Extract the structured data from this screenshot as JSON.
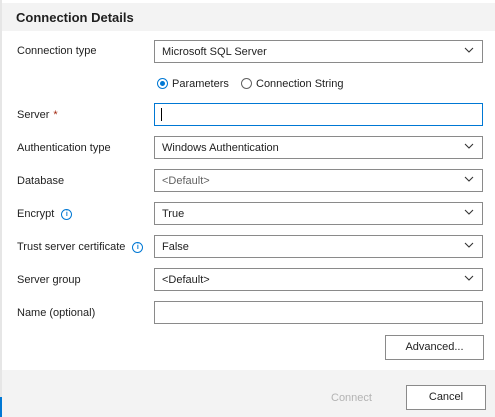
{
  "header": {
    "title": "Connection Details"
  },
  "form": {
    "connection_type": {
      "label": "Connection type",
      "value": "Microsoft SQL Server"
    },
    "mode": {
      "option1": "Parameters",
      "option2": "Connection String",
      "selected": "Parameters"
    },
    "server": {
      "label": "Server",
      "required_mark": "*",
      "value": ""
    },
    "auth_type": {
      "label": "Authentication type",
      "value": "Windows Authentication"
    },
    "database": {
      "label": "Database",
      "value": "<Default>"
    },
    "encrypt": {
      "label": "Encrypt",
      "value": "True"
    },
    "trust_cert": {
      "label": "Trust server certificate",
      "value": "False"
    },
    "server_group": {
      "label": "Server group",
      "value": "<Default>"
    },
    "name": {
      "label": "Name (optional)",
      "value": ""
    }
  },
  "buttons": {
    "advanced": "Advanced...",
    "connect": "Connect",
    "cancel": "Cancel"
  },
  "colors": {
    "accent": "#0078d4",
    "required": "#a1260d",
    "panel": "#f3f3f3"
  }
}
